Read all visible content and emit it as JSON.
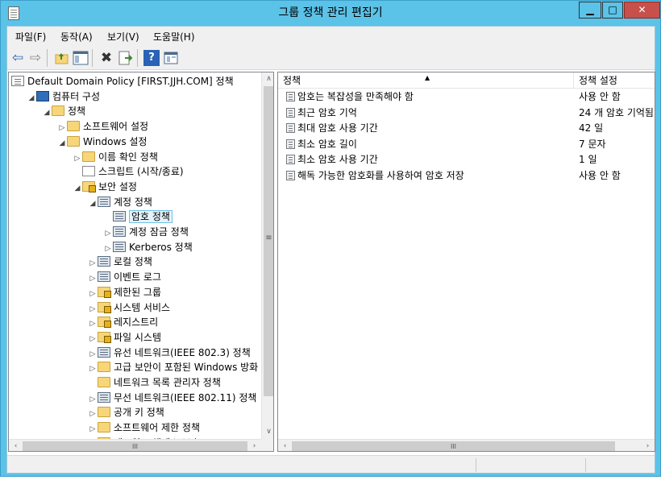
{
  "window": {
    "title": "그룹 정책 관리 편집기",
    "min_glyph": "▁",
    "max_glyph": "□",
    "close_glyph": "✕"
  },
  "menu": [
    "파일(F)",
    "동작(A)",
    "보기(V)",
    "도움말(H)"
  ],
  "toolbar": {
    "icons": [
      "back-arrow-icon",
      "forward-arrow-icon",
      "up-folder-icon",
      "show-hide-tree-icon",
      "delete-icon",
      "export-list-icon",
      "help-icon",
      "properties-view-icon"
    ],
    "glyphs": {
      "back": "⇦",
      "forward": "⇨",
      "delete": "✖",
      "help": "?"
    }
  },
  "tree": {
    "nodes": [
      {
        "label": "Default Domain Policy [FIRST.JJH.COM] 정책",
        "level": 0,
        "expander": "",
        "icon": "document-icon"
      },
      {
        "label": "컴퓨터 구성",
        "level": 1,
        "expander": "◢",
        "icon": "computer-icon"
      },
      {
        "label": "정책",
        "level": 2,
        "expander": "◢",
        "icon": "folder-icon"
      },
      {
        "label": "소프트웨어 설정",
        "level": 3,
        "expander": "▷",
        "icon": "folder-icon"
      },
      {
        "label": "Windows 설정",
        "level": 3,
        "expander": "◢",
        "icon": "folder-icon"
      },
      {
        "label": "이름 확인 정책",
        "level": 4,
        "expander": "▷",
        "icon": "folder-icon"
      },
      {
        "label": "스크립트 (시작/종료)",
        "level": 4,
        "expander": "",
        "icon": "script-icon"
      },
      {
        "label": "보안 설정",
        "level": 4,
        "expander": "◢",
        "icon": "security-settings-icon"
      },
      {
        "label": "계정 정책",
        "level": 5,
        "expander": "◢",
        "icon": "policy-folder-icon"
      },
      {
        "label": "암호 정책",
        "level": 6,
        "expander": "",
        "icon": "policy-folder-icon",
        "selected": true
      },
      {
        "label": "계정 잠금 정책",
        "level": 6,
        "expander": "▷",
        "icon": "policy-folder-icon"
      },
      {
        "label": "Kerberos 정책",
        "level": 6,
        "expander": "▷",
        "icon": "policy-folder-icon"
      },
      {
        "label": "로컬 정책",
        "level": 5,
        "expander": "▷",
        "icon": "policy-folder-icon"
      },
      {
        "label": "이벤트 로그",
        "level": 5,
        "expander": "▷",
        "icon": "policy-folder-icon"
      },
      {
        "label": "제한된 그룹",
        "level": 5,
        "expander": "▷",
        "icon": "lock-folder-icon"
      },
      {
        "label": "시스템 서비스",
        "level": 5,
        "expander": "▷",
        "icon": "lock-folder-icon"
      },
      {
        "label": "레지스트리",
        "level": 5,
        "expander": "▷",
        "icon": "lock-folder-icon"
      },
      {
        "label": "파일 시스템",
        "level": 5,
        "expander": "▷",
        "icon": "lock-folder-icon"
      },
      {
        "label": "유선 네트워크(IEEE 802.3) 정책",
        "level": 5,
        "expander": "▷",
        "icon": "wired-network-icon"
      },
      {
        "label": "고급 보안이 포함된 Windows 방화",
        "level": 5,
        "expander": "▷",
        "icon": "folder-icon"
      },
      {
        "label": "네트워크 목록 관리자 정책",
        "level": 5,
        "expander": "",
        "icon": "folder-icon"
      },
      {
        "label": "무선 네트워크(IEEE 802.11) 정책",
        "level": 5,
        "expander": "▷",
        "icon": "wireless-network-icon"
      },
      {
        "label": "공개 키 정책",
        "level": 5,
        "expander": "▷",
        "icon": "folder-icon"
      },
      {
        "label": "소프트웨어 제한 정책",
        "level": 5,
        "expander": "▷",
        "icon": "folder-icon"
      },
      {
        "label": "네트워크 액세스 보호",
        "level": 5,
        "expander": "▷",
        "icon": "folder-icon"
      }
    ],
    "scroll_up": "∧",
    "scroll_down": "∨",
    "scroll_left": "‹",
    "scroll_right": "›",
    "thumb_grip": "≡",
    "hthumb_grip": "III"
  },
  "list": {
    "columns": [
      "정책",
      "정책 설정"
    ],
    "sort_glyph": "▲",
    "rows": [
      {
        "policy": "암호는 복잡성을 만족해야 함",
        "setting": "사용 안 함"
      },
      {
        "policy": "최근 암호 기억",
        "setting": "24 개 암호 기억됨"
      },
      {
        "policy": "최대 암호 사용 기간",
        "setting": "42 일"
      },
      {
        "policy": "최소 암호 길이",
        "setting": "7 문자"
      },
      {
        "policy": "최소 암호 사용 기간",
        "setting": "1 일"
      },
      {
        "policy": "해독 가능한 암호화를 사용하여 암호 저장",
        "setting": "사용 안 함"
      }
    ],
    "scroll_left": "‹",
    "scroll_right": "›",
    "hthumb_grip": "III"
  }
}
